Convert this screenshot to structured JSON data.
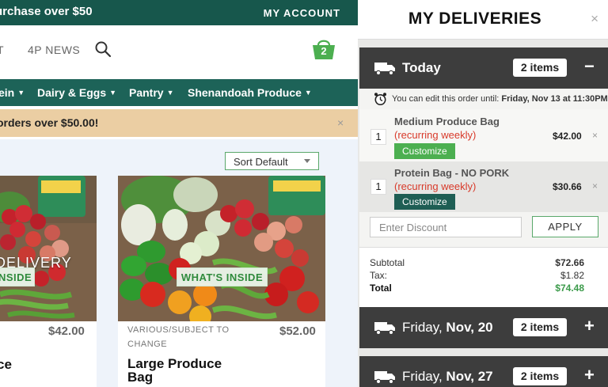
{
  "store": {
    "promo_text": "urchase over $50",
    "account_label": "MY ACCOUNT",
    "nav": {
      "partial": "T",
      "news": "4P NEWS"
    },
    "cart_count": "2",
    "categories": [
      "ein",
      "Dairy & Eggs",
      "Pantry",
      "Shenandoah Produce"
    ],
    "shipping_text": "orders over $50.00!",
    "shipping_close": "×",
    "sort_label": "Sort Default",
    "products": [
      {
        "overlay": "DELIVERY",
        "badge": "NSIDE",
        "price": "$42.00",
        "title": "ce"
      },
      {
        "badge": "WHAT'S INSIDE",
        "price": "$52.00",
        "variety": "VARIOUS/SUBJECT TO CHANGE",
        "title": "Large Produce Bag"
      }
    ]
  },
  "drawer": {
    "title": "MY DELIVERIES",
    "close": "×",
    "edit_prefix": "You can edit this order until:",
    "edit_deadline": "Friday, Nov 13 at 11:30PM",
    "days": [
      {
        "label": "Today",
        "label_bold": "",
        "items": "2 items",
        "toggle": "−"
      },
      {
        "label": "Friday, ",
        "label_bold": "Nov, 20",
        "items": "2 items",
        "toggle": "+"
      },
      {
        "label": "Friday, ",
        "label_bold": "Nov, 27",
        "items": "2 items",
        "toggle": "+"
      }
    ],
    "line_items": [
      {
        "qty": "1",
        "name": "Medium Produce Bag",
        "recurring": "(recurring weekly)",
        "customize": "Customize",
        "customize_color": "#4caf50",
        "price": "$42.00",
        "remove": "×"
      },
      {
        "qty": "1",
        "name": "Protein Bag - NO PORK",
        "recurring": "(recurring weekly)",
        "customize": "Customize",
        "customize_color": "#1e5e54",
        "price": "$30.66",
        "remove": "×"
      }
    ],
    "discount_placeholder": "Enter Discount",
    "apply_label": "APPLY",
    "totals": {
      "subtotal_label": "Subtotal",
      "subtotal": "$72.66",
      "tax_label": "Tax:",
      "tax": "$1.82",
      "total_label": "Total",
      "total": "$74.48"
    }
  }
}
